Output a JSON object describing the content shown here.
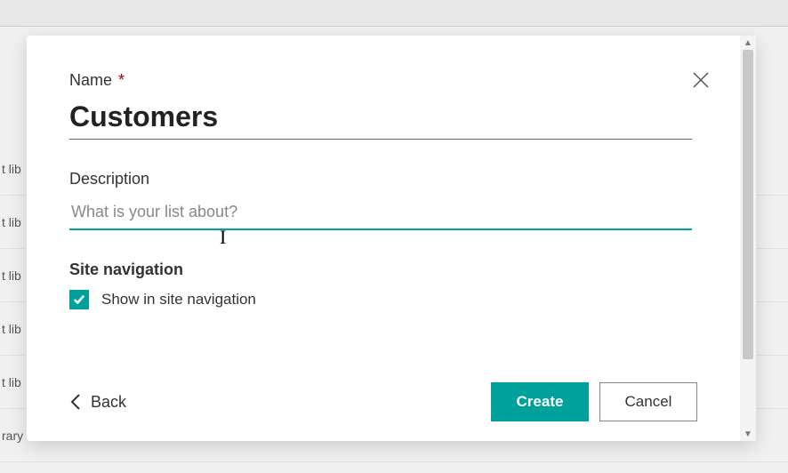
{
  "backdrop": {
    "rows": [
      "t lib",
      "t lib",
      "t lib",
      "t lib",
      "t lib",
      "rary"
    ]
  },
  "dialog": {
    "nameLabel": "Name",
    "requiredMark": "*",
    "nameValue": "Customers",
    "descLabel": "Description",
    "descPlaceholder": "What is your list about?",
    "descValue": "",
    "navHeading": "Site navigation",
    "navCheckboxLabel": "Show in site navigation",
    "navCheckboxChecked": true,
    "backLabel": "Back",
    "createLabel": "Create",
    "cancelLabel": "Cancel"
  },
  "colors": {
    "accent": "#00a19a"
  }
}
